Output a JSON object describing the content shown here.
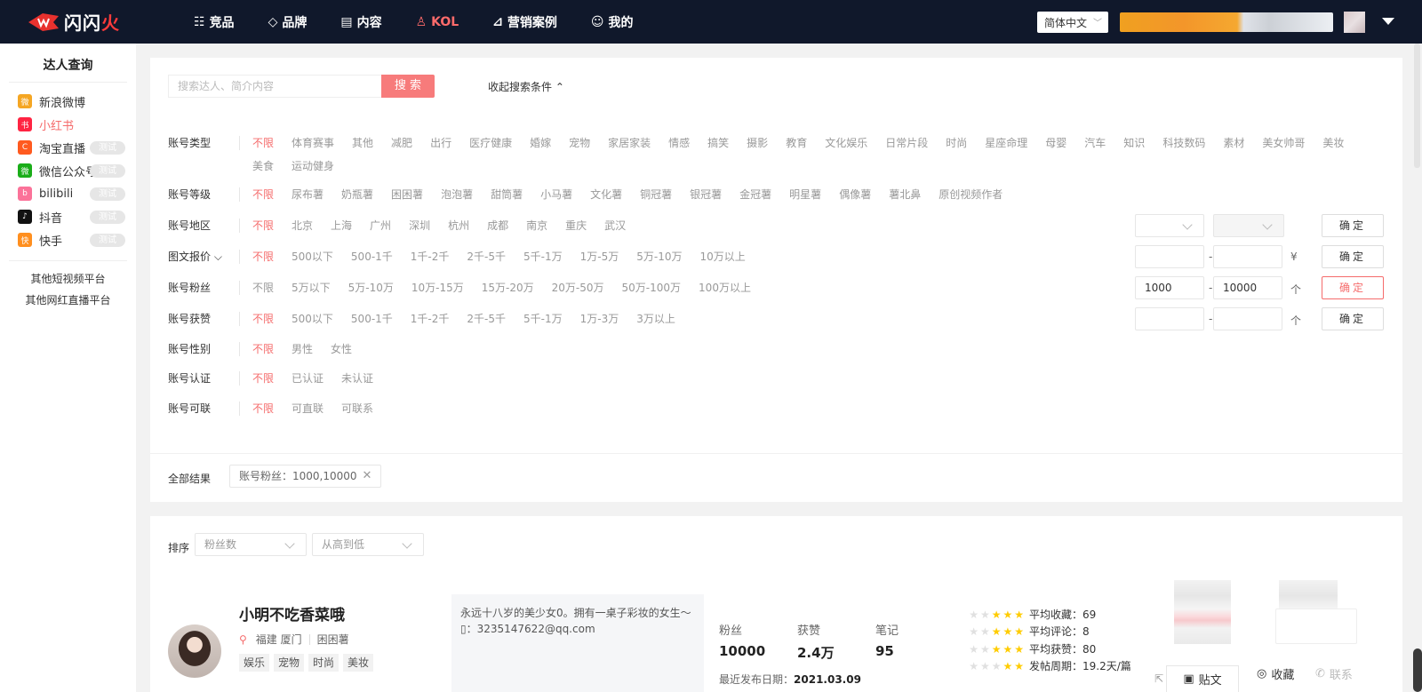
{
  "logo": {
    "text_white": "闪闪",
    "text_red": "火"
  },
  "nav": [
    {
      "icon": "☷",
      "label": "竞品"
    },
    {
      "icon": "◇",
      "label": "品牌"
    },
    {
      "icon": "▤",
      "label": "内容"
    },
    {
      "icon": "♙",
      "label": "KOL"
    },
    {
      "icon": "⊿",
      "label": "营销案例"
    },
    {
      "icon": "☺",
      "label": "我的"
    }
  ],
  "lang": {
    "label": "简体中文",
    "chevron": "﹀"
  },
  "sidebar": {
    "title": "达人查询",
    "items": [
      {
        "label": "新浪微博",
        "icon_color": "#f5a623",
        "icon_text": "微",
        "trial": ""
      },
      {
        "label": "小红书",
        "icon_color": "#ff2442",
        "icon_text": "书",
        "trial": ""
      },
      {
        "label": "淘宝直播",
        "icon_color": "#ff5a1f",
        "icon_text": "C",
        "trial": "测试"
      },
      {
        "label": "微信公众号",
        "icon_color": "#1aad19",
        "icon_text": "微",
        "trial": "测试"
      },
      {
        "label": "bilibili",
        "icon_color": "#fb7299",
        "icon_text": "b",
        "trial": "测试"
      },
      {
        "label": "抖音",
        "icon_color": "#111111",
        "icon_text": "♪",
        "trial": "测试"
      },
      {
        "label": "快手",
        "icon_color": "#ff8f1f",
        "icon_text": "快",
        "trial": "测试"
      }
    ],
    "links": [
      "其他短视频平台",
      "其他网红直播平台"
    ]
  },
  "search": {
    "placeholder": "搜索达人、简介内容",
    "button": "搜 索",
    "collapse": "收起搜索条件 ⌃"
  },
  "filters": {
    "type": {
      "label": "账号类型",
      "options": [
        "不限",
        "体育赛事",
        "其他",
        "减肥",
        "出行",
        "医疗健康",
        "婚嫁",
        "宠物",
        "家居家装",
        "情感",
        "搞笑",
        "摄影",
        "教育",
        "文化娱乐",
        "日常片段",
        "时尚",
        "星座命理",
        "母婴",
        "汽车",
        "知识",
        "科技数码",
        "素材",
        "美女帅哥",
        "美妆",
        "美食",
        "运动健身"
      ]
    },
    "level": {
      "label": "账号等级",
      "options": [
        "不限",
        "尿布薯",
        "奶瓶薯",
        "困困薯",
        "泡泡薯",
        "甜筒薯",
        "小马薯",
        "文化薯",
        "铜冠薯",
        "银冠薯",
        "金冠薯",
        "明星薯",
        "偶像薯",
        "薯北鼻",
        "原创视频作者"
      ]
    },
    "region": {
      "label": "账号地区",
      "options": [
        "不限",
        "北京",
        "上海",
        "广州",
        "深圳",
        "杭州",
        "成都",
        "南京",
        "重庆",
        "武汉"
      ]
    },
    "price": {
      "label": "图文报价 ⌵",
      "options": [
        "不限",
        "500以下",
        "500-1千",
        "1千-2千",
        "2千-5千",
        "5千-1万",
        "1万-5万",
        "5万-10万",
        "10万以上"
      ],
      "unit": "¥"
    },
    "fans": {
      "label": "账号粉丝",
      "options": [
        "不限",
        "5万以下",
        "5万-10万",
        "10万-15万",
        "15万-20万",
        "20万-50万",
        "50万-100万",
        "100万以上"
      ],
      "min": "1000",
      "max": "10000",
      "unit": "个"
    },
    "likes": {
      "label": "账号获赞",
      "options": [
        "不限",
        "500以下",
        "500-1千",
        "1千-2千",
        "2千-5千",
        "5千-1万",
        "1万-3万",
        "3万以上"
      ],
      "unit": "个"
    },
    "gender": {
      "label": "账号性别",
      "options": [
        "不限",
        "男性",
        "女性"
      ]
    },
    "verify": {
      "label": "账号认证",
      "options": [
        "不限",
        "已认证",
        "未认证"
      ]
    },
    "contact": {
      "label": "账号可联",
      "options": [
        "不限",
        "可直联",
        "可联系"
      ]
    },
    "confirm": "确定",
    "dash": "-"
  },
  "result": {
    "label": "全部结果",
    "tag": "账号粉丝：1000,10000",
    "close": "✕"
  },
  "sort": {
    "label": "排序",
    "by": "粉丝数",
    "order": "从高到低"
  },
  "kol": {
    "name": "小明不吃香菜哦",
    "location": "福建 厦门",
    "level": "困困薯",
    "tags": [
      "娱乐",
      "宠物",
      "时尚",
      "美妆"
    ],
    "bio_line1": "永远十八岁的美少女0。拥有一桌子彩妆的女生～",
    "bio_line2": "▯：3235147622@qq.com",
    "stats": [
      {
        "label": "粉丝",
        "value": "10000"
      },
      {
        "label": "获赞",
        "value": "2.4万"
      },
      {
        "label": "笔记",
        "value": "95"
      }
    ],
    "last_label": "最近发布日期：",
    "last_date": "2021.03.09",
    "ratings": [
      {
        "text": "平均收藏：69"
      },
      {
        "text": "平均评论：8"
      },
      {
        "text": "平均获赞：80"
      },
      {
        "text": "发帖周期：19.2天/篇"
      }
    ],
    "actions": {
      "post": "贴文",
      "fav": "收藏",
      "contact": "联系"
    }
  }
}
